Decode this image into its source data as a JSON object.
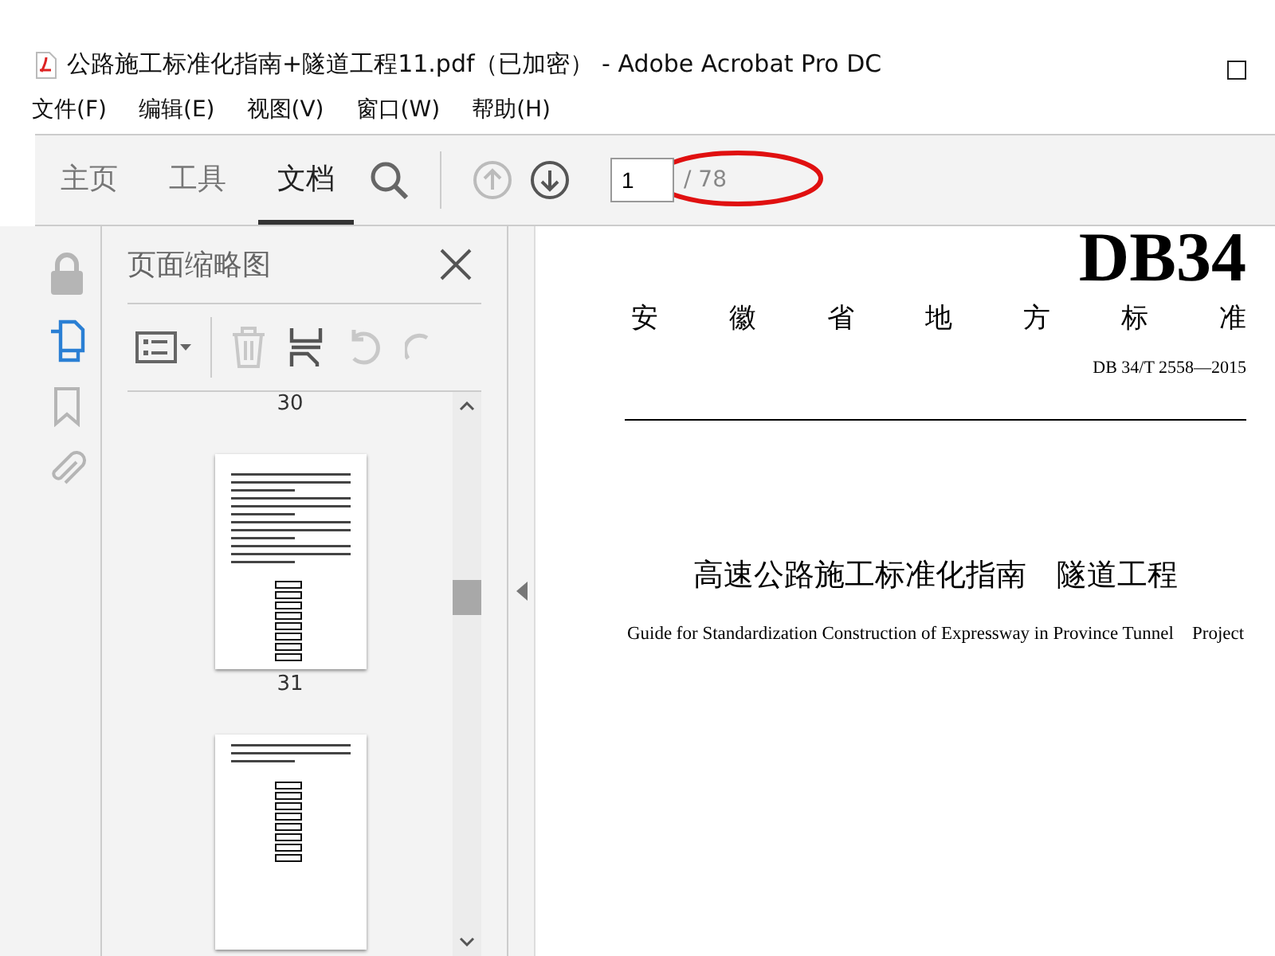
{
  "window": {
    "title": "公路施工标准化指南+隧道工程11.pdf（已加密） - Adobe Acrobat Pro DC"
  },
  "menu": [
    "文件(F)",
    "编辑(E)",
    "视图(V)",
    "窗口(W)",
    "帮助(H)"
  ],
  "tabs": [
    {
      "label": "主页",
      "selected": false
    },
    {
      "label": "工具",
      "selected": false
    },
    {
      "label": "文档",
      "selected": true
    }
  ],
  "page_nav": {
    "value": "1",
    "total": "/ 78"
  },
  "panel": {
    "title": "页面缩略图",
    "thumbnails": [
      {
        "kind": "label",
        "label": "30"
      },
      {
        "kind": "page",
        "label": "31"
      },
      {
        "kind": "page"
      }
    ]
  },
  "document": {
    "code_title": "DB34",
    "issuer": [
      "安",
      "徽",
      "省",
      "地",
      "方",
      "标",
      "准"
    ],
    "standard_no": "DB 34/T  2558—2015",
    "title": "高速公路施工标准化指南　隧道工程",
    "subtitle": "Guide for Standardization Construction of Expressway in Province Tunnel    Project"
  }
}
